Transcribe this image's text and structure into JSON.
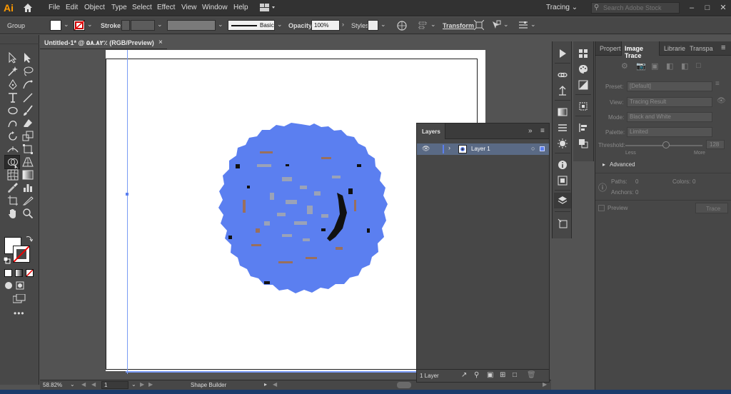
{
  "app": {
    "logo": "Ai"
  },
  "menu": [
    "File",
    "Edit",
    "Object",
    "Type",
    "Select",
    "Effect",
    "View",
    "Window",
    "Help"
  ],
  "workspace": {
    "label": "Tracing"
  },
  "search": {
    "placeholder": "Search Adobe Stock"
  },
  "control_bar": {
    "selection_label": "Group",
    "stroke_label": "Stroke:",
    "brush_label": "Basic",
    "opacity_label": "Opacity:",
    "opacity_value": "100%",
    "styles_label": "Styles:",
    "transform_label": "Transform"
  },
  "document": {
    "tab_title": "Untitled-1* @ ۵۸.۸۲٪ (RGB/Preview)"
  },
  "status_bar": {
    "zoom": "58.82%",
    "artboard_number": "1",
    "current_tool": "Shape Builder"
  },
  "layers_panel": {
    "title": "Layers",
    "layer_name": "Layer 1",
    "layer_count": "1 Layer"
  },
  "image_trace": {
    "tabs": [
      "Properti",
      "Image Trace",
      "Librarie",
      "Transpa"
    ],
    "preset_label": "Preset:",
    "preset_value": "[Default]",
    "view_label": "View:",
    "view_value": "Tracing Result",
    "mode_label": "Mode:",
    "mode_value": "Black and White",
    "palette_label": "Palette:",
    "palette_value": "Limited",
    "threshold_label": "Threshold:",
    "threshold_value": "128",
    "threshold_less": "Less",
    "threshold_more": "More",
    "advanced_label": "Advanced",
    "paths_label": "Paths:",
    "paths_value": "0",
    "colors_label": "Colors:",
    "colors_value": "0",
    "anchors_label": "Anchors:",
    "anchors_value": "0",
    "preview_label": "Preview",
    "trace_button": "Trace"
  },
  "colors": {
    "accent_blue": "#5b7ff0",
    "ai_orange": "#ff9a00",
    "panel_bg": "#474747",
    "canvas_bg": "#535353"
  }
}
